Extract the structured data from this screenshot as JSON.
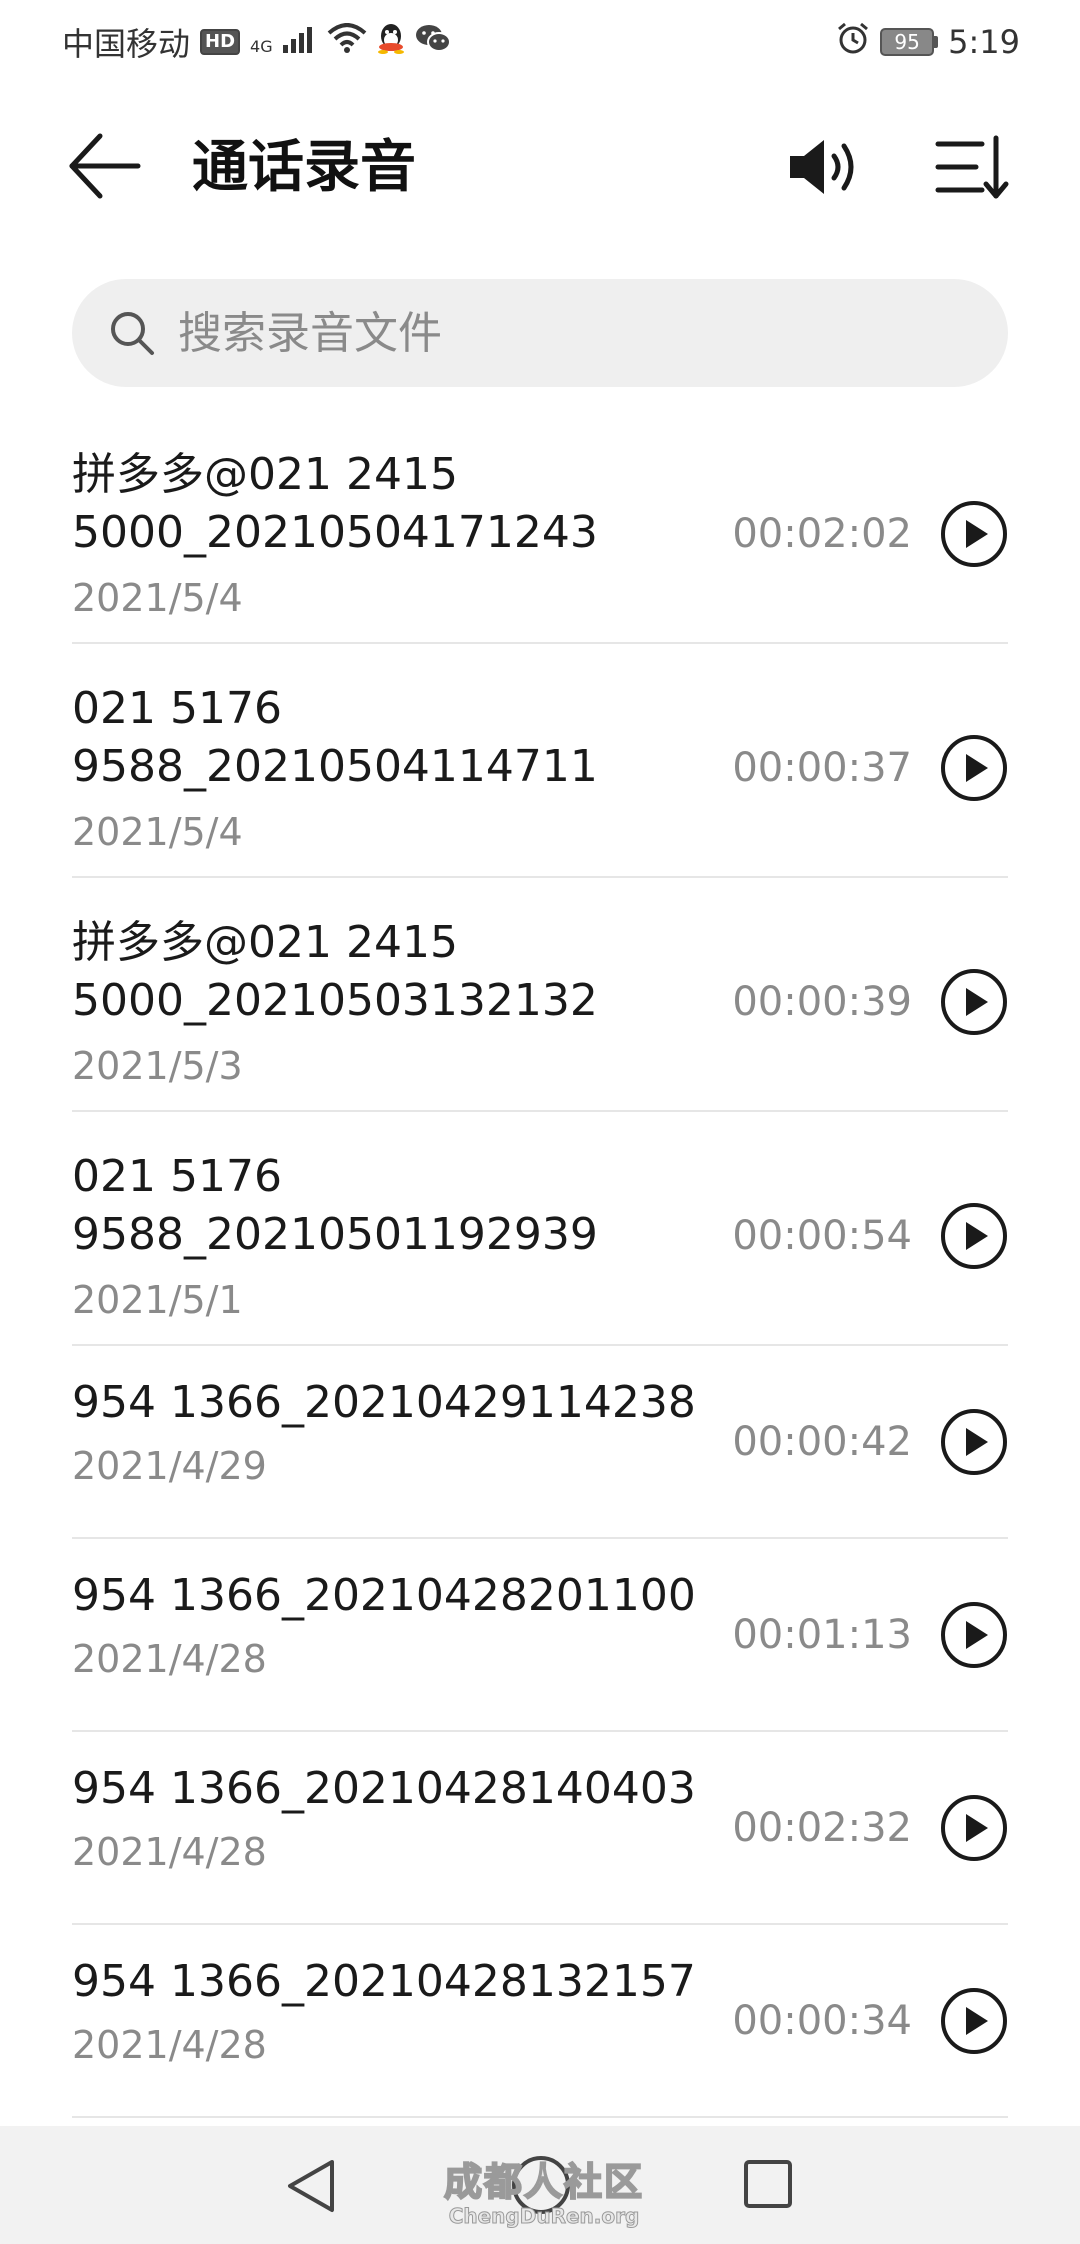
{
  "status_bar": {
    "carrier": "中国移动",
    "hd": "HD",
    "network": "4G",
    "battery": "95",
    "time": "5:19"
  },
  "app_bar": {
    "title": "通话录音",
    "icons": [
      "back-arrow-icon",
      "speaker-icon",
      "sort-icon"
    ]
  },
  "search": {
    "placeholder": "搜索录音文件"
  },
  "recordings": [
    {
      "name": "拼多多@021 2415\n5000_20210504171243",
      "date": "2021/5/4",
      "duration": "00:02:02"
    },
    {
      "name": "021 5176\n9588_20210504114711",
      "date": "2021/5/4",
      "duration": "00:00:37"
    },
    {
      "name": "拼多多@021 2415\n5000_20210503132132",
      "date": "2021/5/3",
      "duration": "00:00:39"
    },
    {
      "name": "021 5176\n9588_20210501192939",
      "date": "2021/5/1",
      "duration": "00:00:54"
    },
    {
      "name": "954 1366_20210429114238",
      "date": "2021/4/29",
      "duration": "00:00:42"
    },
    {
      "name": "954 1366_20210428201100",
      "date": "2021/4/28",
      "duration": "00:01:13"
    },
    {
      "name": "954 1366_20210428140403",
      "date": "2021/4/28",
      "duration": "00:02:32"
    },
    {
      "name": "954 1366_20210428132157",
      "date": "2021/4/28",
      "duration": "00:00:34"
    }
  ],
  "watermark": {
    "cn": "成都人社区",
    "en": "ChengDuRen.org"
  },
  "colors": {
    "text_primary": "#1a1a1a",
    "text_secondary": "#8a8a8a",
    "search_bg": "#efefef",
    "divider": "#e6e6e6",
    "nav_bg": "#f2f2f2"
  }
}
